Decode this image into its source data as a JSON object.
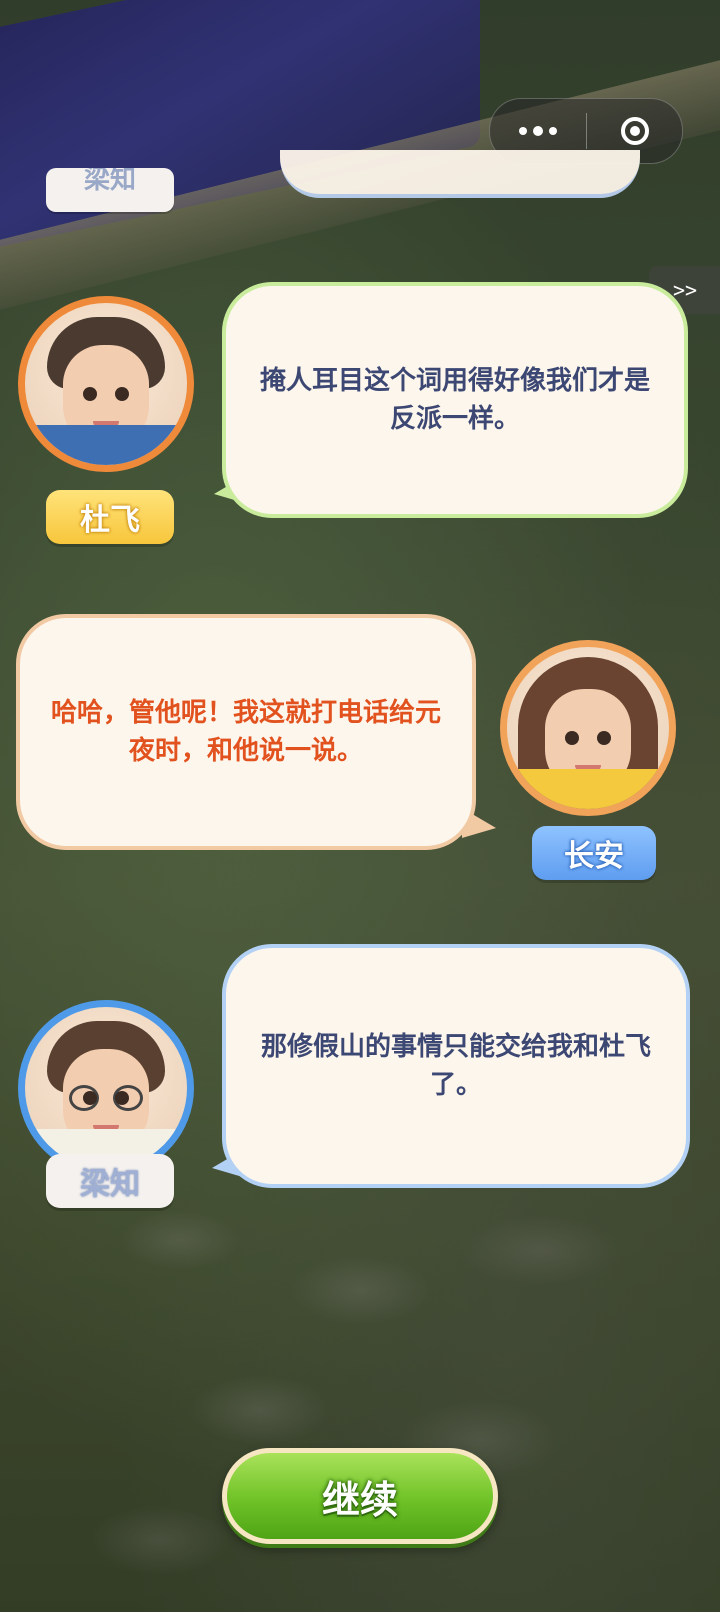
{
  "capsule": {
    "more_icon": "more-dots-icon",
    "close_icon": "target-close-icon"
  },
  "skip_label": ">>",
  "previous": {
    "speaker": "梁知"
  },
  "dialogs": [
    {
      "speaker": "杜飞",
      "text": "掩人耳目这个词用得好像我们才是反派一样。",
      "text_color": "#3c4873",
      "border_color": "#c9ec9c"
    },
    {
      "speaker": "长安",
      "text": "哈哈，管他呢！我这就打电话给元夜时，和他说一说。",
      "text_color": "#e2521f",
      "border_color": "#f1c9a3"
    },
    {
      "speaker": "梁知",
      "text": "那修假山的事情只能交给我和杜飞了。",
      "text_color": "#3c4873",
      "border_color": "#b3d1f4"
    }
  ],
  "continue_label": "继续"
}
